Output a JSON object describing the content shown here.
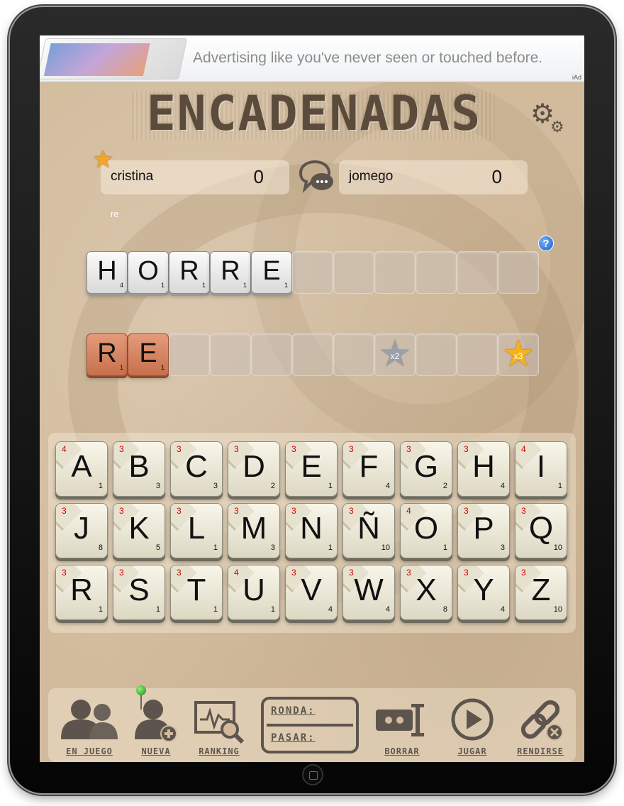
{
  "ad": {
    "text": "Advertising like you've never seen or touched before.",
    "badge": "iAd"
  },
  "game": {
    "title": "ENCADENADAS",
    "settings_icon": "gear-icon"
  },
  "players": [
    {
      "name": "cristina",
      "score": "0",
      "current_turn": true
    },
    {
      "name": "jomego",
      "score": "0",
      "current_turn": false
    }
  ],
  "current_word_hint": "re",
  "help_label": "?",
  "board": {
    "row1": [
      {
        "letter": "H",
        "points": "4"
      },
      {
        "letter": "O",
        "points": "1"
      },
      {
        "letter": "R",
        "points": "1"
      },
      {
        "letter": "R",
        "points": "1"
      },
      {
        "letter": "E",
        "points": "1"
      },
      {},
      {},
      {},
      {},
      {},
      {}
    ],
    "row2": [
      {
        "letter": "R",
        "points": "1",
        "style": "orange"
      },
      {
        "letter": "E",
        "points": "1",
        "style": "orange"
      },
      {},
      {},
      {},
      {},
      {},
      {
        "bonus": "x2",
        "bonus_color": "silver"
      },
      {},
      {},
      {
        "bonus": "x3",
        "bonus_color": "gold"
      }
    ]
  },
  "keyboard": [
    [
      {
        "letter": "A",
        "count": "4",
        "points": "1"
      },
      {
        "letter": "B",
        "count": "3",
        "points": "3"
      },
      {
        "letter": "C",
        "count": "3",
        "points": "3"
      },
      {
        "letter": "D",
        "count": "3",
        "points": "2"
      },
      {
        "letter": "E",
        "count": "3",
        "points": "1"
      },
      {
        "letter": "F",
        "count": "3",
        "points": "4"
      },
      {
        "letter": "G",
        "count": "3",
        "points": "2"
      },
      {
        "letter": "H",
        "count": "3",
        "points": "4"
      },
      {
        "letter": "I",
        "count": "4",
        "points": "1"
      }
    ],
    [
      {
        "letter": "J",
        "count": "3",
        "points": "8"
      },
      {
        "letter": "K",
        "count": "3",
        "points": "5"
      },
      {
        "letter": "L",
        "count": "3",
        "points": "1"
      },
      {
        "letter": "M",
        "count": "3",
        "points": "3"
      },
      {
        "letter": "N",
        "count": "3",
        "points": "1"
      },
      {
        "letter": "Ñ",
        "count": "3",
        "points": "10"
      },
      {
        "letter": "O",
        "count": "4",
        "points": "1"
      },
      {
        "letter": "P",
        "count": "3",
        "points": "3"
      },
      {
        "letter": "Q",
        "count": "3",
        "points": "10"
      }
    ],
    [
      {
        "letter": "R",
        "count": "3",
        "points": "1"
      },
      {
        "letter": "S",
        "count": "3",
        "points": "1"
      },
      {
        "letter": "T",
        "count": "3",
        "points": "1"
      },
      {
        "letter": "U",
        "count": "4",
        "points": "1"
      },
      {
        "letter": "V",
        "count": "3",
        "points": "4"
      },
      {
        "letter": "W",
        "count": "3",
        "points": "4"
      },
      {
        "letter": "X",
        "count": "3",
        "points": "8"
      },
      {
        "letter": "Y",
        "count": "3",
        "points": "4"
      },
      {
        "letter": "Z",
        "count": "3",
        "points": "10"
      }
    ]
  ],
  "toolbar": {
    "en_juego": "EN JUEGO",
    "nueva": "NUEVA",
    "ranking": "RANKING",
    "ronda": "RONDA:",
    "pasar": "PASAR:",
    "borrar": "BORRAR",
    "jugar": "JUGAR",
    "rendirse": "RENDIRSE"
  },
  "colors": {
    "background": "#d2bb9c",
    "tile_face": "#f8f6ea",
    "tile_orange": "#d27c57",
    "letter_count_red": "#d10000",
    "toolbar_icon": "#5d554d"
  }
}
